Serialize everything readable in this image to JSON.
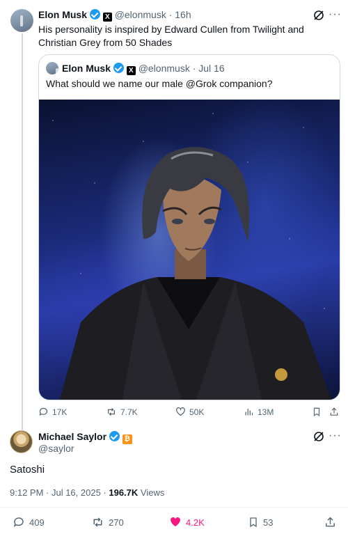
{
  "reply_tweet": {
    "author_name": "Elon Musk",
    "handle": "@elonmusk",
    "time": "· 16h",
    "text": "His personality is inspired by Edward Cullen from Twilight and Christian Grey from 50 Shades"
  },
  "quoted_tweet": {
    "author_name": "Elon Musk",
    "handle": "@elonmusk",
    "time": "· Jul 16",
    "text": "What should we name our male @Grok companion?"
  },
  "reply_actions": {
    "replies": "17K",
    "reposts": "7.7K",
    "likes": "50K",
    "views": "13M"
  },
  "main_tweet": {
    "author_name": "Michael Saylor",
    "handle": "@saylor",
    "text": "Satoshi",
    "timestamp": "9:12 PM · Jul 16, 2025 · ",
    "views_count": "196.7K",
    "views_label": " Views"
  },
  "main_actions": {
    "replies": "409",
    "reposts": "270",
    "likes": "4.2K",
    "bookmarks": "53"
  },
  "icons": {
    "verified": "verified-badge-icon",
    "x_affiliate": "x-logo-icon",
    "btc_affiliate": "bitcoin-icon",
    "grok": "grok-icon",
    "more": "more-icon"
  },
  "colors": {
    "verified_blue": "#1d9bf0",
    "like_pink": "#f91880",
    "muted": "#536471"
  }
}
